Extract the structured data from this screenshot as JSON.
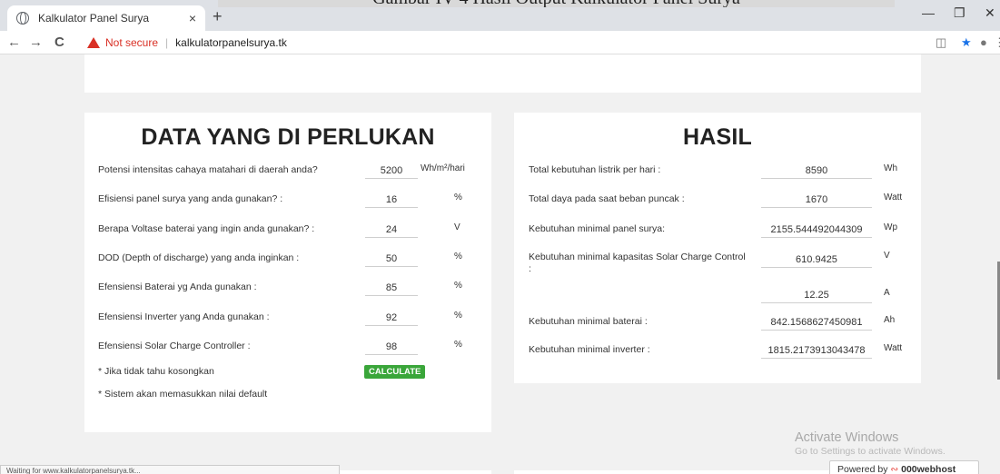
{
  "caption": {
    "text": "Gambar IV-4 Hasil Output Kalkulator Panel Surya"
  },
  "browser": {
    "tab_title": "Kalkulator Panel Surya",
    "tab_close": "×",
    "new_tab": "+",
    "back": "←",
    "forward": "→",
    "reload": "C",
    "not_secure": "Not secure",
    "url": "kalkulatorpanelsurya.tk",
    "status": "Waiting for www.kalkulatorpanelsurya.tk..."
  },
  "left_panel": {
    "title": "DATA YANG DI PERLUKAN",
    "rows": [
      {
        "label": "Potensi intensitas cahaya matahari di daerah anda?",
        "value": "5200",
        "unit": "Wh/m²/hari"
      },
      {
        "label": "Efisiensi panel surya yang anda gunakan? :",
        "value": "16",
        "unit": "%"
      },
      {
        "label": "Berapa Voltase baterai yang ingin anda gunakan? :",
        "value": "24",
        "unit": "V"
      },
      {
        "label": "DOD (Depth of discharge) yang anda inginkan :",
        "value": "50",
        "unit": "%"
      },
      {
        "label": "Efensiensi Baterai yg Anda gunakan :",
        "value": "85",
        "unit": "%"
      },
      {
        "label": "Efensiensi Inverter yang Anda gunakan :",
        "value": "92",
        "unit": "%"
      },
      {
        "label": "Efensiensi Solar Charge Controller :",
        "value": "98",
        "unit": "%"
      }
    ],
    "note1": "* Jika tidak tahu kosongkan",
    "note2": "* Sistem akan memasukkan nilai default",
    "calculate_label": "CALCULATE"
  },
  "right_panel": {
    "title": "HASIL",
    "rows": [
      {
        "label": "Total kebutuhan listrik per hari :",
        "value": "8590",
        "unit": "Wh"
      },
      {
        "label": "Total daya pada saat beban puncak :",
        "value": "1670",
        "unit": "Watt"
      },
      {
        "label": "Kebutuhan minimal panel surya:",
        "value": "2155.544492044309",
        "unit": "Wp"
      },
      {
        "label": "Kebutuhan minimal kapasitas Solar Charge Control :",
        "value": "610.9425",
        "unit": "V"
      },
      {
        "label": "",
        "value": "12.25",
        "unit": "A"
      },
      {
        "label": "Kebutuhan minimal baterai :",
        "value": "842.1568627450981",
        "unit": "Ah"
      },
      {
        "label": "Kebutuhan minimal inverter :",
        "value": "1815.2173913043478",
        "unit": "Watt"
      }
    ]
  },
  "overlay": {
    "activate_title": "Activate Windows",
    "activate_sub": "Go to Settings to activate Windows.",
    "powered_by": "Powered by",
    "host": "000webhost"
  }
}
